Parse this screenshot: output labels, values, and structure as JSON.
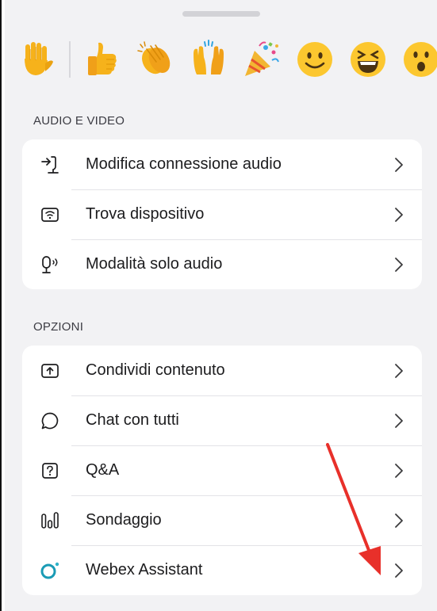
{
  "reactions": [
    {
      "name": "raised-hand"
    },
    {
      "name": "thumbs-up"
    },
    {
      "name": "clapping-hands"
    },
    {
      "name": "raising-hands"
    },
    {
      "name": "party-popper"
    },
    {
      "name": "smiling-face"
    },
    {
      "name": "laughing-face"
    },
    {
      "name": "surprised-face"
    }
  ],
  "sections": {
    "audio_video": {
      "header": "AUDIO E VIDEO",
      "items": [
        {
          "label": "Modifica connessione audio",
          "icon": "audio-connection-icon"
        },
        {
          "label": "Trova dispositivo",
          "icon": "find-device-icon"
        },
        {
          "label": "Modalità solo audio",
          "icon": "audio-only-icon"
        }
      ]
    },
    "options": {
      "header": "OPZIONI",
      "items": [
        {
          "label": "Condividi contenuto",
          "icon": "share-content-icon"
        },
        {
          "label": "Chat con tutti",
          "icon": "chat-bubble-icon"
        },
        {
          "label": "Q&A",
          "icon": "question-icon"
        },
        {
          "label": "Sondaggio",
          "icon": "poll-icon"
        },
        {
          "label": "Webex Assistant",
          "icon": "webex-assistant-icon"
        }
      ]
    }
  },
  "colors": {
    "sheet_background": "#f2f2f4",
    "card_background": "#ffffff",
    "text": "#1c1c1e",
    "header_text": "#3c3c43",
    "annotation_arrow": "#e8302a",
    "assistant_accent": "#2fb3c9"
  }
}
